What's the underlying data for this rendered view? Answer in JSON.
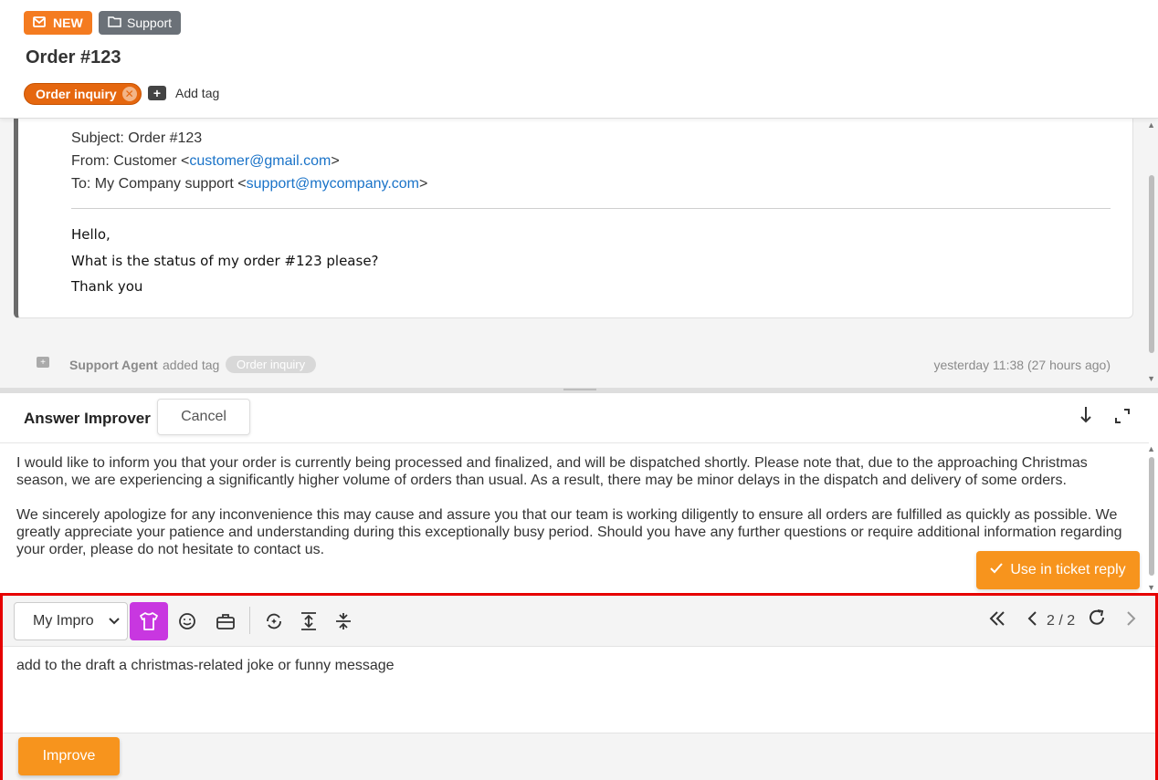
{
  "header": {
    "badge_new": "NEW",
    "badge_support": "Support",
    "title": "Order #123",
    "tag": "Order inquiry",
    "add_tag": "Add tag"
  },
  "email": {
    "subject": "Subject: Order #123",
    "from_prefix": "From: Customer <",
    "from_email": "customer@gmail.com",
    "from_suffix": ">",
    "to_prefix": "To: My Company support <",
    "to_email": "support@mycompany.com",
    "to_suffix": ">",
    "body": [
      "Hello,",
      "What is the status of my order #123 please?",
      "Thank you"
    ]
  },
  "activity": {
    "agent": "Support Agent",
    "action": "added tag",
    "tag": "Order inquiry",
    "time": "yesterday 11:38 (27 hours ago)"
  },
  "answer_improver": {
    "title": "Answer Improver",
    "cancel_label": "Cancel",
    "paragraphs": [
      "I would like to inform you that your order is currently being processed and finalized, and will be dispatched shortly. Please note that, due to the approaching Christmas season, we are experiencing a significantly higher volume of orders than usual. As a result, there may be minor delays in the dispatch and delivery of some orders.",
      "We sincerely apologize for any inconvenience this may cause and assure you that our team is working diligently to ensure all orders are fulfilled as quickly as possible. We greatly appreciate your patience and understanding during this exceptionally busy period. Should you have any further questions or require additional information regarding your order, please do not hesitate to contact us."
    ],
    "use_label": "Use in ticket reply"
  },
  "improve_panel": {
    "select_value": "My Impro",
    "page_indicator": "2 / 2",
    "prompt": "add to the draft a christmas-related joke or funny message",
    "improve_label": "Improve"
  },
  "colors": {
    "accent_orange": "#f7941d",
    "new_badge": "#f47b20",
    "tag_orange": "#e5670f",
    "active_tool": "#c837e0",
    "highlight_border": "#e60000",
    "link": "#1a73c8"
  },
  "icons": [
    "mail-icon",
    "folder-icon",
    "remove-tag-icon",
    "add-tag-icon",
    "tshirt-icon",
    "smiley-icon",
    "briefcase-icon",
    "sparkle-refresh-icon",
    "expand-vertical-icon",
    "collapse-vertical-icon",
    "first-page-icon",
    "prev-page-icon",
    "refresh-icon",
    "next-page-icon",
    "arrow-down-icon",
    "fullscreen-icon",
    "check-icon"
  ]
}
